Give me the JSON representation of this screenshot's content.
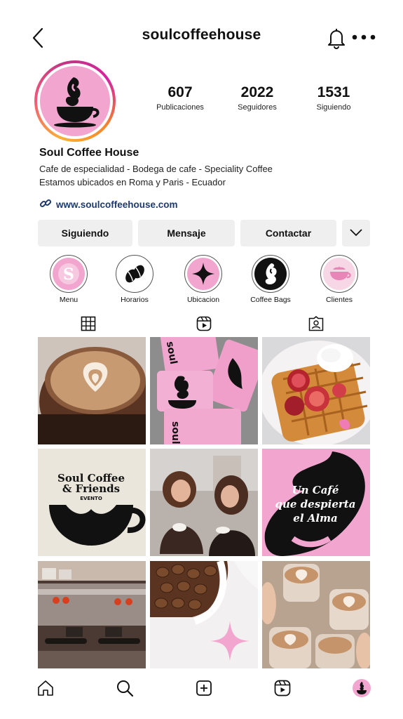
{
  "header": {
    "username": "soulcoffeehouse",
    "icons": [
      "back-arrow-icon",
      "bell-icon",
      "more-dots-icon"
    ]
  },
  "profile": {
    "stats": [
      {
        "value": "607",
        "label": "Publicaciones"
      },
      {
        "value": "2022",
        "label": "Seguidores"
      },
      {
        "value": "1531",
        "label": "Siguiendo"
      }
    ],
    "name": "Soul Coffee House",
    "bio_lines": [
      "Cafe de especialidad - Bodega de cafe - Speciality Coffee",
      "Estamos ubicados en Roma y Paris - Ecuador"
    ],
    "link": "www.soulcoffeehouse.com"
  },
  "buttons": {
    "following": "Siguiendo",
    "message": "Mensaje",
    "contact": "Contactar"
  },
  "highlights": [
    {
      "label": "Menu"
    },
    {
      "label": "Horarios"
    },
    {
      "label": "Ubicacion"
    },
    {
      "label": "Coffee Bags"
    },
    {
      "label": "Clientes"
    }
  ],
  "posts": {
    "post5": {
      "line1": "Soul Coffee",
      "line2": "& Friends",
      "line3": "EVENTO"
    },
    "post7": {
      "line1": "Un Café",
      "line2": "que despierta",
      "line3": "el Alma"
    },
    "cup_text": "soul"
  },
  "colors": {
    "brand_pink": "#f2a6cf",
    "brand_black": "#111111",
    "link": "#1e3a6e",
    "button_bg": "#efefef"
  }
}
